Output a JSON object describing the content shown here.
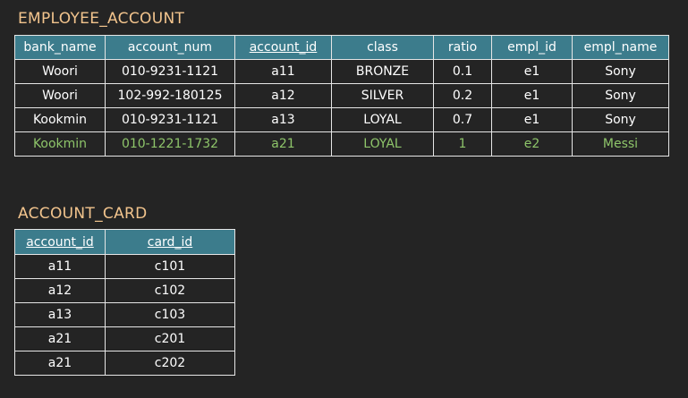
{
  "employee_account": {
    "title": "EMPLOYEE_ACCOUNT",
    "columns": [
      {
        "label": "bank_name",
        "key": false
      },
      {
        "label": "account_num",
        "key": false
      },
      {
        "label": "account_id",
        "key": true
      },
      {
        "label": "class",
        "key": false
      },
      {
        "label": "ratio",
        "key": false
      },
      {
        "label": "empl_id",
        "key": false
      },
      {
        "label": "empl_name",
        "key": false
      }
    ],
    "rows": [
      {
        "cells": [
          "Woori",
          "010-9231-1121",
          "a11",
          "BRONZE",
          "0.1",
          "e1",
          "Sony"
        ],
        "highlight": false
      },
      {
        "cells": [
          "Woori",
          "102-992-180125",
          "a12",
          "SILVER",
          "0.2",
          "e1",
          "Sony"
        ],
        "highlight": false
      },
      {
        "cells": [
          "Kookmin",
          "010-9231-1121",
          "a13",
          "LOYAL",
          "0.7",
          "e1",
          "Sony"
        ],
        "highlight": false
      },
      {
        "cells": [
          "Kookmin",
          "010-1221-1732",
          "a21",
          "LOYAL",
          "1",
          "e2",
          "Messi"
        ],
        "highlight": true
      }
    ]
  },
  "account_card": {
    "title": "ACCOUNT_CARD",
    "columns": [
      {
        "label": "account_id",
        "key": true
      },
      {
        "label": "card_id",
        "key": true
      }
    ],
    "rows": [
      {
        "cells": [
          "a11",
          "c101"
        ],
        "highlight": false
      },
      {
        "cells": [
          "a12",
          "c102"
        ],
        "highlight": false
      },
      {
        "cells": [
          "a13",
          "c103"
        ],
        "highlight": false
      },
      {
        "cells": [
          "a21",
          "c201"
        ],
        "highlight": false
      },
      {
        "cells": [
          "a21",
          "c202"
        ],
        "highlight": false
      }
    ]
  },
  "colors": {
    "background": "#242424",
    "title": "#f2c48d",
    "header_fill": "#3c7c8c",
    "highlight_text": "#8ec56a"
  }
}
